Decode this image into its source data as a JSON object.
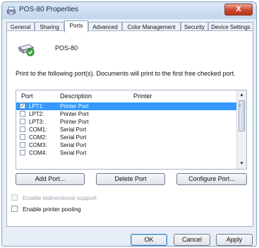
{
  "window": {
    "title": "POS-80 Properties",
    "close_label": "X"
  },
  "tabs": [
    "General",
    "Sharing",
    "Ports",
    "Advanced",
    "Color Management",
    "Security",
    "Device Settings"
  ],
  "active_tab": "Ports",
  "printer_name": "POS-80",
  "instructions": "Print to the following port(s). Documents will print to the first free checked port.",
  "columns": {
    "port": "Port",
    "description": "Description",
    "printer": "Printer"
  },
  "ports": [
    {
      "port": "LPT1:",
      "description": "Printer Port",
      "checked": true,
      "selected": true
    },
    {
      "port": "LPT2:",
      "description": "Printer Port",
      "checked": false,
      "selected": false
    },
    {
      "port": "LPT3:",
      "description": "Printer Port",
      "checked": false,
      "selected": false
    },
    {
      "port": "COM1:",
      "description": "Serial Port",
      "checked": false,
      "selected": false
    },
    {
      "port": "COM2:",
      "description": "Serial Port",
      "checked": false,
      "selected": false
    },
    {
      "port": "COM3:",
      "description": "Serial Port",
      "checked": false,
      "selected": false
    },
    {
      "port": "COM4:",
      "description": "Serial Port",
      "checked": false,
      "selected": false
    }
  ],
  "buttons": {
    "add_port": "Add Port...",
    "delete_port": "Delete Port",
    "configure_port": "Configure Port..."
  },
  "options": {
    "bidirectional": {
      "label": "Enable bidirectional support",
      "checked": false,
      "enabled": false
    },
    "pooling": {
      "label": "Enable printer pooling",
      "checked": false,
      "enabled": true
    }
  },
  "footer": {
    "ok": "OK",
    "cancel": "Cancel",
    "apply": "Apply"
  }
}
